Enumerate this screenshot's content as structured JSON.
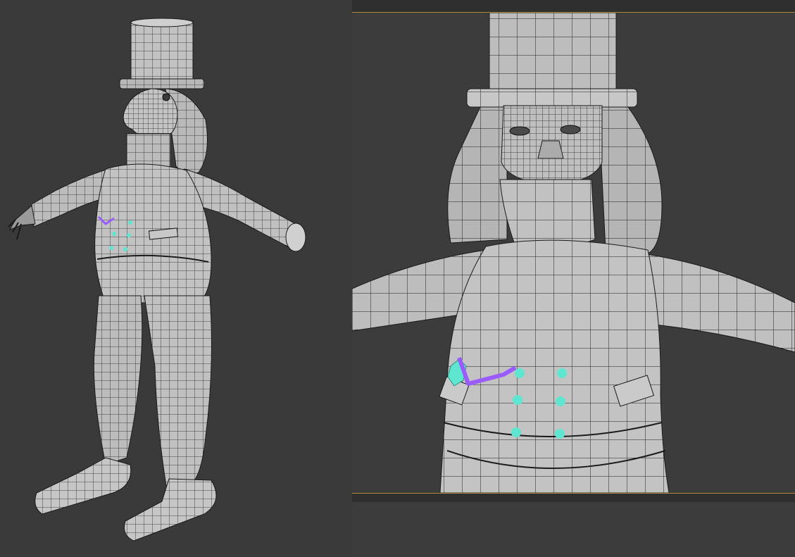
{
  "scene": {
    "colors": {
      "background": "#3a3a3a",
      "mesh_fill": "#bdbdbd",
      "mesh_shade": "#8f8f8f",
      "wire": "#1a1a1a",
      "viewport_border": "#b08a3a",
      "button_cyan": "#5fe6d0",
      "selection_purple": "#9b5cff"
    },
    "viewports": [
      {
        "name": "perspective-full-body",
        "object": "character-mesh",
        "shading": "wireframe-on-shaded"
      },
      {
        "name": "front-closeup",
        "object": "character-mesh",
        "shading": "wireframe-on-shaded"
      }
    ]
  }
}
